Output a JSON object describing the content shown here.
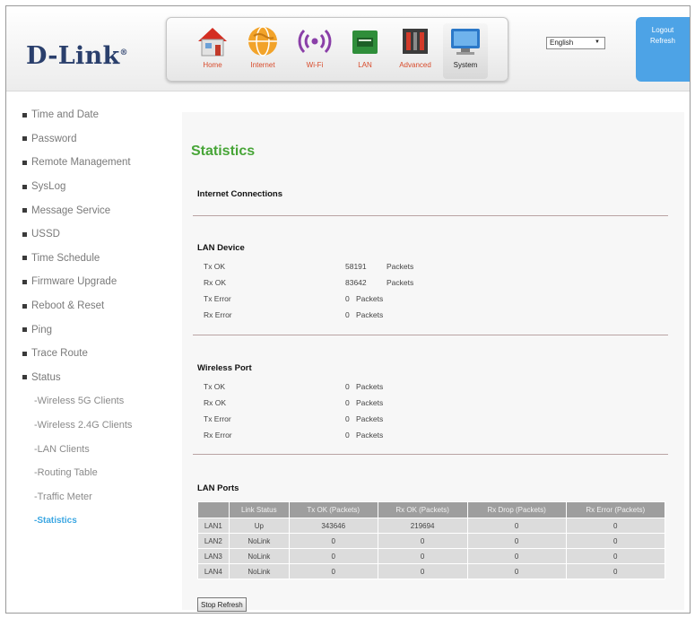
{
  "brand": {
    "name": "D-Link",
    "mark": "®"
  },
  "nav": [
    {
      "label": "Home",
      "icon": "home-icon"
    },
    {
      "label": "Internet",
      "icon": "globe-icon"
    },
    {
      "label": "Wi-Fi",
      "icon": "wifi-icon"
    },
    {
      "label": "LAN",
      "icon": "lan-icon"
    },
    {
      "label": "Advanced",
      "icon": "advanced-icon"
    },
    {
      "label": "System",
      "icon": "monitor-icon",
      "active": true
    }
  ],
  "language": {
    "selected": "English"
  },
  "account": {
    "logout": "Logout",
    "refresh": "Refresh"
  },
  "sidebar": {
    "items": [
      {
        "label": "Time and Date"
      },
      {
        "label": "Password"
      },
      {
        "label": "Remote Management"
      },
      {
        "label": "SysLog"
      },
      {
        "label": "Message Service"
      },
      {
        "label": "USSD"
      },
      {
        "label": "Time Schedule"
      },
      {
        "label": "Firmware Upgrade"
      },
      {
        "label": "Reboot & Reset"
      },
      {
        "label": "Ping"
      },
      {
        "label": "Trace Route"
      },
      {
        "label": "Status"
      }
    ],
    "subitems": [
      {
        "label": "-Wireless 5G Clients"
      },
      {
        "label": "-Wireless 2.4G Clients"
      },
      {
        "label": "-LAN Clients"
      },
      {
        "label": "-Routing Table"
      },
      {
        "label": "-Traffic Meter"
      },
      {
        "label": "-Statistics",
        "active": true
      }
    ]
  },
  "page": {
    "title": "Statistics",
    "internet_section": "Internet Connections",
    "lan_device": {
      "title": "LAN Device",
      "rows": [
        {
          "label": "Tx OK",
          "value": "58191",
          "unit": "Packets"
        },
        {
          "label": "Rx OK",
          "value": "83642",
          "unit": "Packets"
        },
        {
          "label": "Tx Error",
          "value": "0",
          "unit": "Packets"
        },
        {
          "label": "Rx Error",
          "value": "0",
          "unit": "Packets"
        }
      ]
    },
    "wireless_port": {
      "title": "Wireless Port",
      "rows": [
        {
          "label": "Tx OK",
          "value": "0",
          "unit": "Packets"
        },
        {
          "label": "Rx OK",
          "value": "0",
          "unit": "Packets"
        },
        {
          "label": "Tx Error",
          "value": "0",
          "unit": "Packets"
        },
        {
          "label": "Rx Error",
          "value": "0",
          "unit": "Packets"
        }
      ]
    },
    "lan_ports": {
      "title": "LAN Ports",
      "headers": [
        "",
        "Link Status",
        "Tx OK (Packets)",
        "Rx OK (Packets)",
        "Rx Drop (Packets)",
        "Rx Error (Packets)"
      ],
      "rows": [
        [
          "LAN1",
          "Up",
          "343646",
          "219694",
          "0",
          "0"
        ],
        [
          "LAN2",
          "NoLink",
          "0",
          "0",
          "0",
          "0"
        ],
        [
          "LAN3",
          "NoLink",
          "0",
          "0",
          "0",
          "0"
        ],
        [
          "LAN4",
          "NoLink",
          "0",
          "0",
          "0",
          "0"
        ]
      ]
    },
    "stop_refresh": "Stop Refresh"
  }
}
